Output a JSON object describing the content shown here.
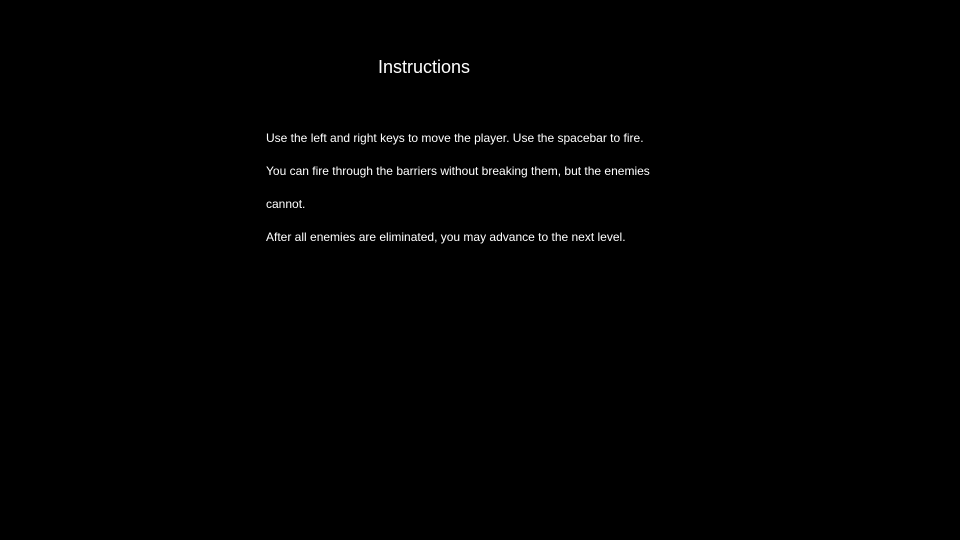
{
  "screen": {
    "title": "Instructions",
    "lines": [
      "Use the left and right keys to move the player. Use the spacebar to fire.",
      "You can fire through the barriers without breaking them, but the enemies",
      "cannot.",
      "After all enemies are eliminated, you may advance to the next level."
    ]
  },
  "colors": {
    "background": "#000000",
    "text": "#ffffff"
  }
}
